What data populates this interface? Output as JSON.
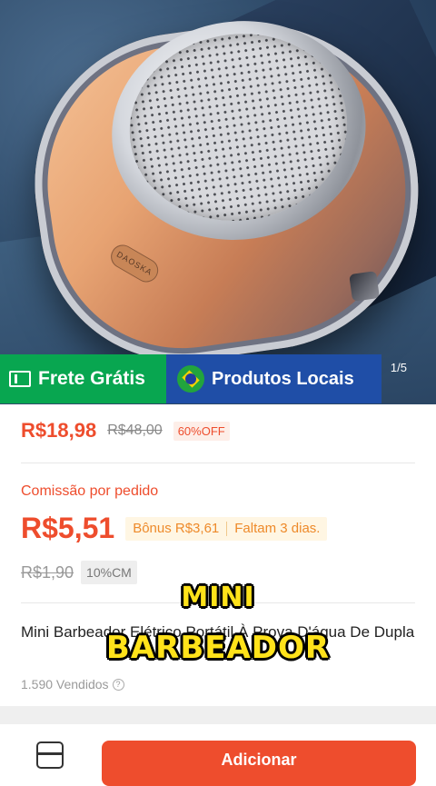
{
  "gallery": {
    "page_indicator": "1/5",
    "logo_text": "DAOSKA"
  },
  "badges": {
    "free_shipping": "Frete Grátis",
    "local_products": "Produtos Locais"
  },
  "price": {
    "current": "R$18,98",
    "original": "R$48,00",
    "discount": "60%OFF"
  },
  "commission": {
    "label": "Comissão por pedido",
    "value": "R$5,51",
    "bonus": "Bônus R$3,61",
    "remaining": "Faltam 3 dias.",
    "old_value": "R$1,90",
    "rate_tag": "10%CM"
  },
  "product": {
    "title": "Mini Barbeador Elétrico Portátil À Prova D'água De Dupla",
    "sold": "1.590 Vendidos"
  },
  "caption": {
    "line1": "MINI",
    "line2": "BARBEADOR"
  },
  "bottom_bar": {
    "add_label": "Adicionar"
  },
  "colors": {
    "accent": "#ee4d2d",
    "free_shipping_bg": "#08a650",
    "local_bg": "#1f4ea7",
    "caption": "#ffe21a"
  }
}
